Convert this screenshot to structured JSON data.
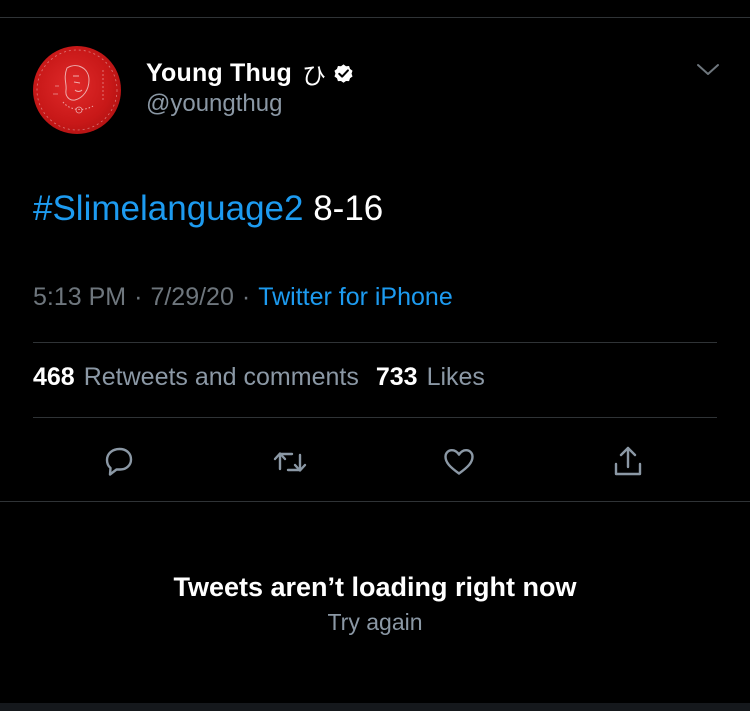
{
  "user": {
    "display_name": "Young Thug",
    "name_glyph": "ひ",
    "handle": "@youngthug",
    "verified": true
  },
  "tweet": {
    "hashtag": "#Slimelanguage2",
    "text_rest": " 8-16",
    "time": "5:13 PM",
    "date": "7/29/20",
    "separator": "·",
    "source": "Twitter for iPhone"
  },
  "stats": {
    "retweets_count": "468",
    "retweets_label": "Retweets and comments",
    "likes_count": "733",
    "likes_label": "Likes"
  },
  "actions": [
    {
      "icon": "reply-icon"
    },
    {
      "icon": "retweet-icon"
    },
    {
      "icon": "like-icon"
    },
    {
      "icon": "share-icon"
    }
  ],
  "notice": {
    "title": "Tweets aren’t loading right now",
    "retry_label": "Try again"
  },
  "colors": {
    "background": "#000000",
    "accent": "#1d9bf0",
    "secondary_text": "#8b98a5",
    "divider": "#2f3336",
    "avatar": "#c81818"
  }
}
